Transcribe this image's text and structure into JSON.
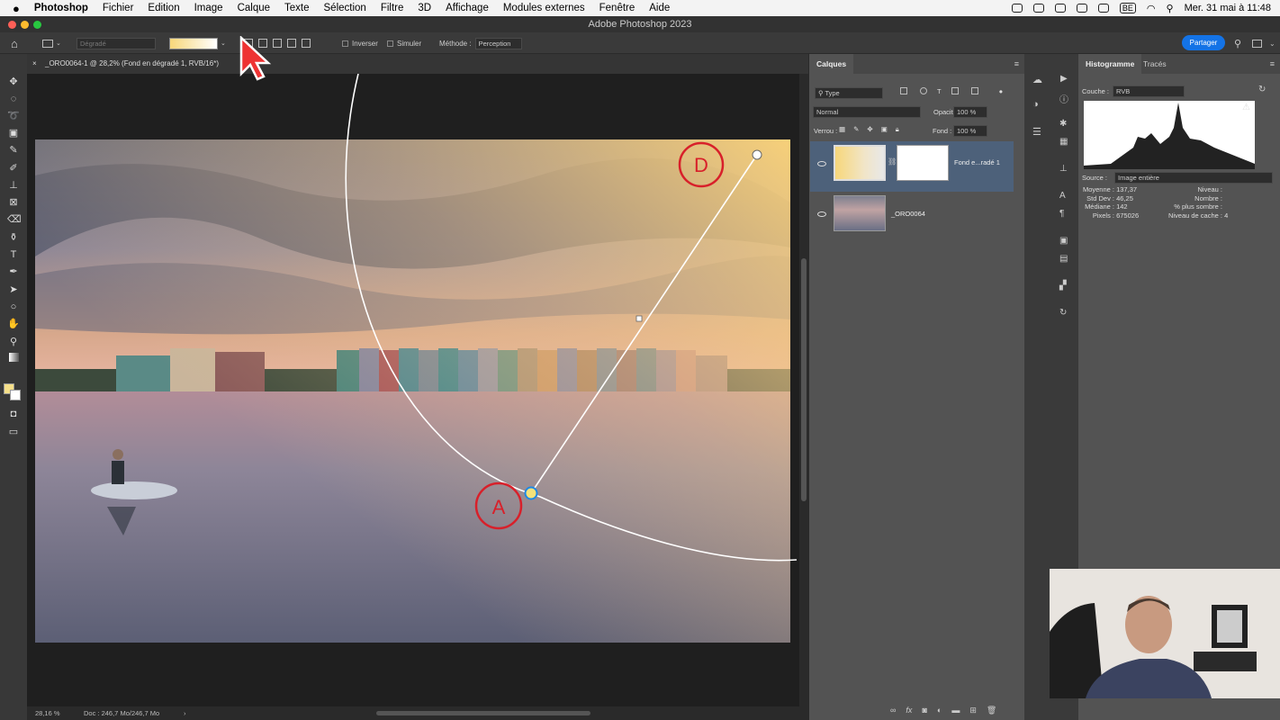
{
  "menubar": {
    "app": "Photoshop",
    "items": [
      "Fichier",
      "Edition",
      "Image",
      "Calque",
      "Texte",
      "Sélection",
      "Filtre",
      "3D",
      "Affichage",
      "Modules externes",
      "Fenêtre",
      "Aide"
    ],
    "region": "BE",
    "clock": "Mer. 31 mai à 11:48"
  },
  "window": {
    "title": "Adobe Photoshop 2023"
  },
  "options": {
    "preset": "Dégradé",
    "invert": "Inverser",
    "simulate": "Simuler",
    "method_label": "Méthode :",
    "method_value": "Perception",
    "share": "Partager"
  },
  "document": {
    "tab": "_ORO0064-1 @ 28,2% (Fond en dégradé 1, RVB/16*)",
    "zoom": "28,16 %",
    "doc_info": "Doc : 246,7 Mo/246,7 Mo",
    "annotations": [
      "D",
      "A"
    ]
  },
  "layers_panel": {
    "tab": "Calques",
    "filter": "Type",
    "blend": "Normal",
    "opacity_label": "Opacité :",
    "opacity": "100 %",
    "lock_label": "Verrou :",
    "fill_label": "Fond :",
    "fill": "100 %",
    "layers": [
      {
        "name": "Fond e...radé 1",
        "selected": true
      },
      {
        "name": "_ORO0064",
        "selected": false
      }
    ]
  },
  "histogram_panel": {
    "tabs": [
      "Histogramme",
      "Tracés"
    ],
    "channel_label": "Couche :",
    "channel": "RVB",
    "source_label": "Source :",
    "source": "Image entière",
    "stats": [
      {
        "k": "Moyenne :",
        "v": "137,37"
      },
      {
        "k": "Std Dev :",
        "v": "46,25"
      },
      {
        "k": "Médiane :",
        "v": "142"
      },
      {
        "k": "Pixels :",
        "v": "675026"
      }
    ],
    "stats2": [
      {
        "k": "Niveau :",
        "v": ""
      },
      {
        "k": "Nombre :",
        "v": ""
      },
      {
        "k": "% plus sombre :",
        "v": ""
      },
      {
        "k": "Niveau de cache :",
        "v": "4"
      }
    ]
  },
  "colors": {
    "accent": "#1473e6",
    "selected_layer": "#4d617a",
    "annotation_red": "#d8202a",
    "handle_yellow": "#f4e27a",
    "foreground_swatch": "#f6e08a"
  }
}
